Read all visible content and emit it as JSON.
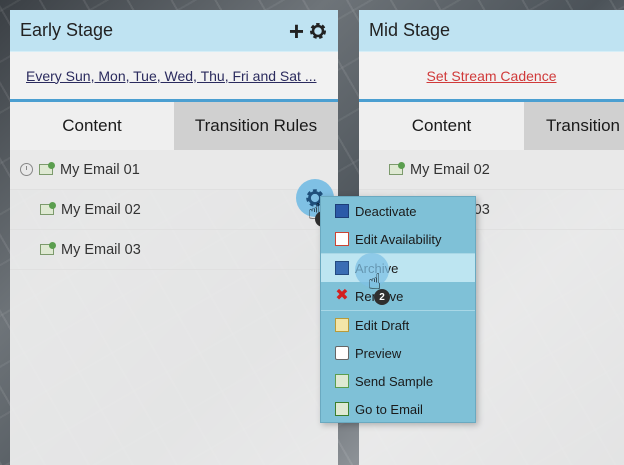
{
  "early_stage": {
    "title": "Early Stage",
    "cadence_link": "Every Sun, Mon, Tue, Wed, Thu, Fri and Sat ...",
    "tabs": [
      "Content",
      "Transition Rules"
    ],
    "emails": [
      "My Email 01",
      "My Email 02",
      "My Email 03"
    ]
  },
  "mid_stage": {
    "title": "Mid Stage",
    "cadence_link": "Set Stream Cadence",
    "tabs": [
      "Content",
      "Transition"
    ],
    "emails": [
      "My Email 02",
      "My Email 03"
    ]
  },
  "context_menu": {
    "items": [
      "Deactivate",
      "Edit Availability",
      "Archive",
      "Remove",
      "Edit Draft",
      "Preview",
      "Send Sample",
      "Go to Email"
    ],
    "highlighted": "Archive"
  },
  "steps": [
    "1",
    "2"
  ],
  "colors": {
    "header_bg": "#bfe3f2",
    "accent": "#4b9fd1",
    "menu_bg": "#7fc1d7",
    "link_red": "#d03a3a"
  }
}
